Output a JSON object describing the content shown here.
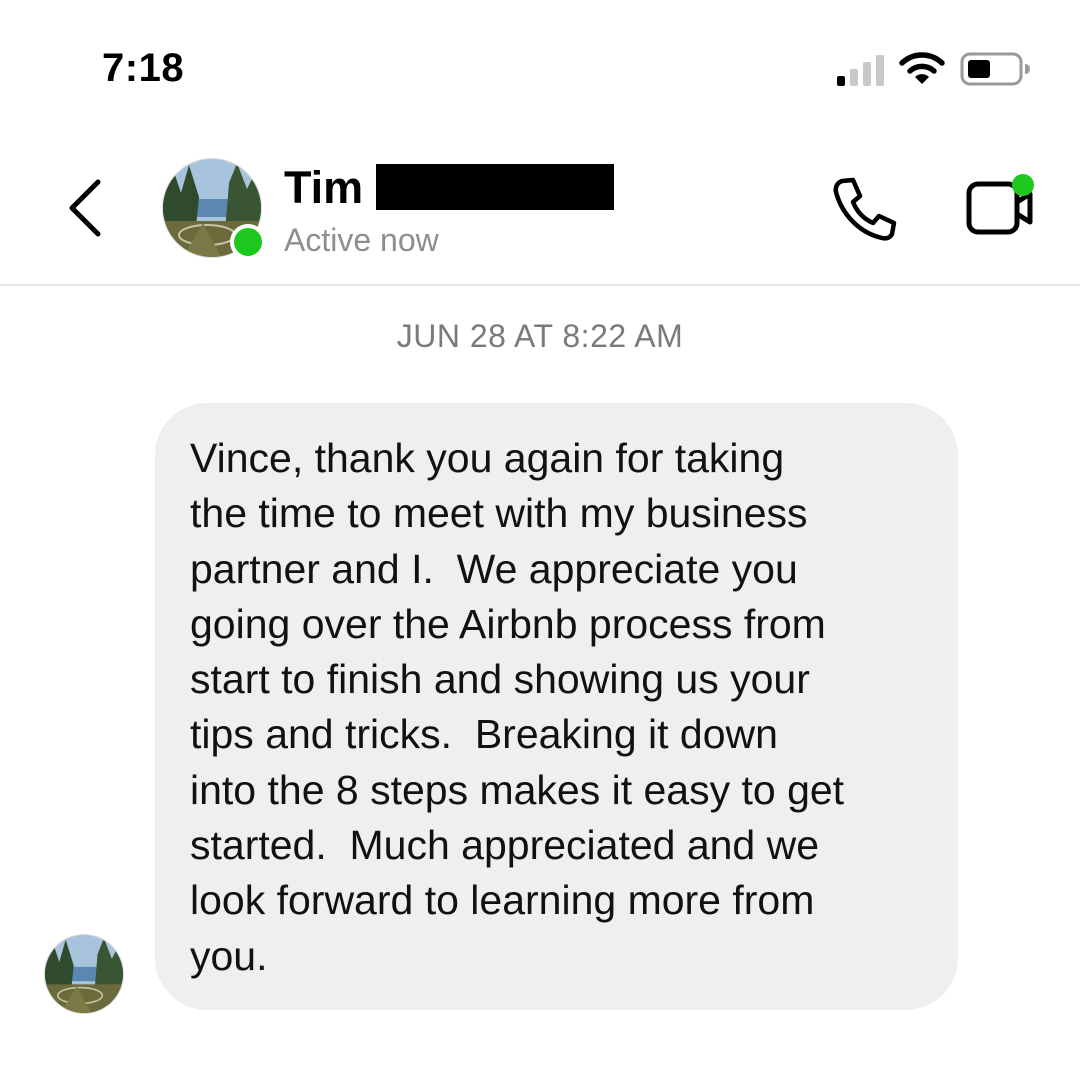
{
  "status_bar": {
    "time": "7:18",
    "signal_icon": "cellular-signal-icon",
    "wifi_icon": "wifi-icon",
    "battery_icon": "battery-icon",
    "signal_bars_active": 1,
    "signal_bars_total": 4,
    "battery_level": 0.4
  },
  "header": {
    "back_icon": "chevron-left-icon",
    "contact_name": "Tim",
    "contact_status": "Active now",
    "call_icon": "phone-icon",
    "video_icon": "video-camera-icon"
  },
  "chat": {
    "timestamp": "JUN 28 AT 8:22 AM",
    "messages": [
      {
        "text": "Vince, thank you again for taking\nthe time to meet with my business\npartner and I.  We appreciate you\ngoing over the Airbnb process from\nstart to finish and showing us your\ntips and tricks.  Breaking it down\ninto the 8 steps makes it easy to get\nstarted.  Much appreciated and we\nlook forward to learning more from\nyou."
      }
    ]
  },
  "colors": {
    "online": "#1ec81e",
    "bubble": "#efefef",
    "secondary_text": "#8e8e8e",
    "divider": "#e6e6e6"
  }
}
